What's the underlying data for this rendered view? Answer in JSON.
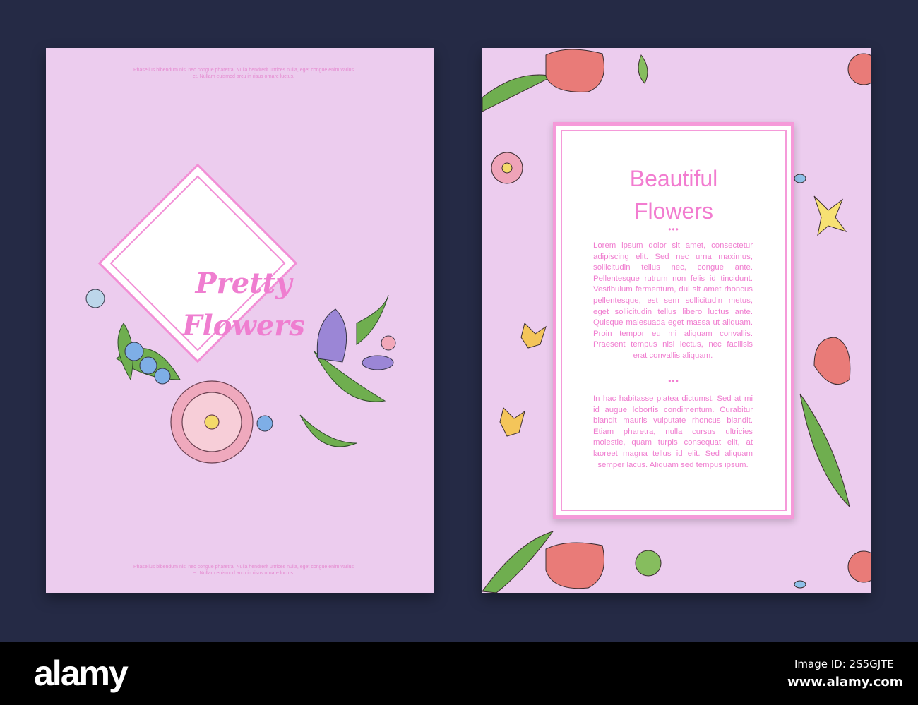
{
  "left_card": {
    "top_text": "Phasellus bibendum nisi nec congue pharetra. Nulla hendrerit ultrices nulla, eget congue enim varius et. Nullam euismod arcu in risus ornare luctus.",
    "title_line1": "Pretty",
    "title_line2": "Flowers",
    "bottom_text": "Phasellus bibendum nisi nec congue pharetra. Nulla hendrerit ultrices nulla, eget congue enim varius et. Nullam euismod arcu in risus ornare luctus."
  },
  "right_card": {
    "title_line1": "Beautiful",
    "title_line2": "Flowers",
    "divider": "•••",
    "paragraph1": "Lorem ipsum dolor sit amet, consectetur adipiscing elit. Sed nec urna maximus, sollicitudin tellus nec, congue ante. Pellentesque rutrum non felis id tincidunt. Vestibulum fermentum, dui sit amet rhoncus pellentesque, est sem sollicitudin metus, eget sollicitudin tellus libero luctus ante. Quisque malesuada eget massa ut aliquam. Proin tempor eu mi aliquam convallis. Praesent tempus nisl lectus, nec facilisis erat convallis aliquam.",
    "paragraph2": "In hac habitasse platea dictumst. Sed at mi id augue lobortis condimentum. Curabitur blandit mauris vulputate rhoncus blandit. Etiam pharetra, nulla cursus ultricies molestie, quam turpis consequat elit, at laoreet magna tellus id elit. Sed aliquam semper lacus. Aliquam sed tempus ipsum."
  },
  "footer": {
    "logo": "alamy",
    "image_id": "Image ID: 2S5GJTE",
    "url": "www.alamy.com"
  },
  "colors": {
    "background": "#252a45",
    "card": "#ecccee",
    "accent": "#f27cd0"
  }
}
